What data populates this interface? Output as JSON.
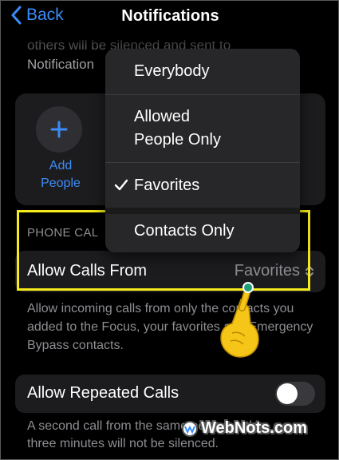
{
  "nav": {
    "back_label": "Back",
    "title": "Notifications"
  },
  "top_note": {
    "line1": "others will be silenced and sent to",
    "line2": "Notification"
  },
  "people": {
    "add_label_1": "Add",
    "add_label_2": "People"
  },
  "section": {
    "header": "PHONE CAL"
  },
  "calls_row": {
    "label": "Allow Calls From",
    "value": "Favorites"
  },
  "description": "Allow incoming calls from only the contacts you added to the Focus, your favorites and Emergency Bypass contacts.",
  "repeated": {
    "label": "Allow Repeated Calls",
    "toggle_on": false
  },
  "footer": {
    "line1": "A second call from the same person within",
    "line2": "three minutes will not be silenced."
  },
  "menu": {
    "items": [
      {
        "label": "Everybody",
        "checked": false
      },
      {
        "label_line1": "Allowed",
        "label_line2": "People Only",
        "checked": false
      },
      {
        "label": "Favorites",
        "checked": true
      },
      {
        "label": "Contacts Only",
        "checked": false
      }
    ]
  },
  "watermark": {
    "text": "WebNots.com"
  },
  "colors": {
    "accent": "#3b8cf7",
    "highlight": "#f4ea1c",
    "hand": "#f5c518",
    "dot": "#1f9e7a"
  }
}
